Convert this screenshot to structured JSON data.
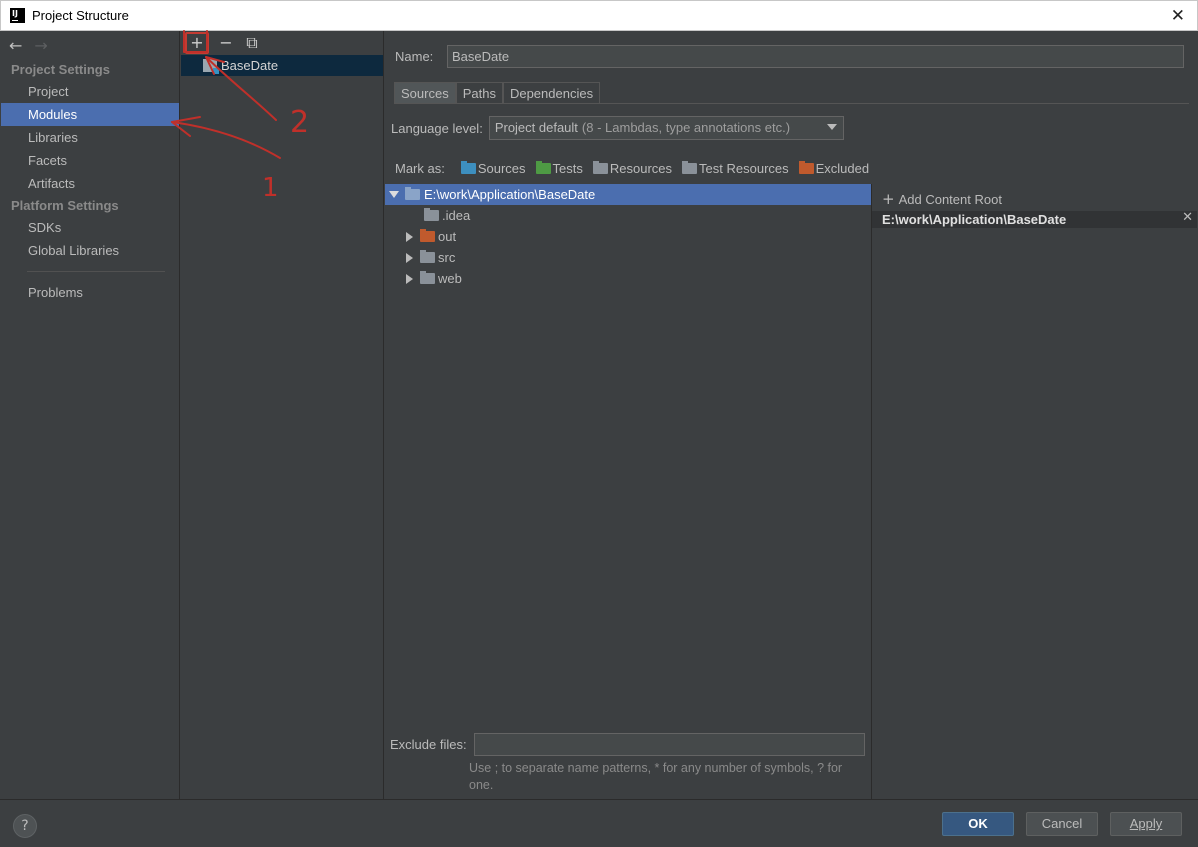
{
  "window": {
    "title": "Project Structure"
  },
  "sidebar": {
    "project_settings_title": "Project Settings",
    "items": [
      {
        "label": "Project"
      },
      {
        "label": "Modules"
      },
      {
        "label": "Libraries"
      },
      {
        "label": "Facets"
      },
      {
        "label": "Artifacts"
      }
    ],
    "platform_settings_title": "Platform Settings",
    "platform_items": [
      {
        "label": "SDKs"
      },
      {
        "label": "Global Libraries"
      }
    ],
    "problems_label": "Problems"
  },
  "modules": {
    "list": [
      {
        "name": "BaseDate"
      }
    ]
  },
  "main": {
    "name_label": "Name:",
    "name_value": "BaseDate",
    "tabs": [
      {
        "label": "Sources"
      },
      {
        "label": "Paths"
      },
      {
        "label": "Dependencies"
      }
    ],
    "language_level_label": "Language level:",
    "language_level_value": "Project default",
    "language_level_detail": "(8 - Lambdas, type annotations etc.)",
    "mark_as_label": "Mark as:",
    "mark_as": [
      {
        "label": "Sources",
        "color": "#3d8fbf"
      },
      {
        "label": "Tests",
        "color": "#4e9a44"
      },
      {
        "label": "Resources",
        "color": "#8a9199"
      },
      {
        "label": "Test Resources",
        "color": "#8a9199"
      },
      {
        "label": "Excluded",
        "color": "#c05a2d"
      }
    ],
    "tree": {
      "root": "E:\\work\\Application\\BaseDate",
      "children": [
        {
          "name": ".idea",
          "color": "#8a9199"
        },
        {
          "name": "out",
          "color": "#c05a2d"
        },
        {
          "name": "src",
          "color": "#8a9199"
        },
        {
          "name": "web",
          "color": "#8a9199"
        }
      ]
    },
    "add_content_root_label": "Add Content Root",
    "content_root_path": "E:\\work\\Application\\BaseDate",
    "exclude_files_label": "Exclude files:",
    "exclude_files_value": "",
    "exclude_hint": "Use ; to separate name patterns, * for any number of symbols, ? for one."
  },
  "footer": {
    "help_label": "?",
    "ok_label": "OK",
    "cancel_label": "Cancel",
    "apply_label": "Apply"
  },
  "annotations": {
    "label_1": "1",
    "label_2": "2"
  }
}
